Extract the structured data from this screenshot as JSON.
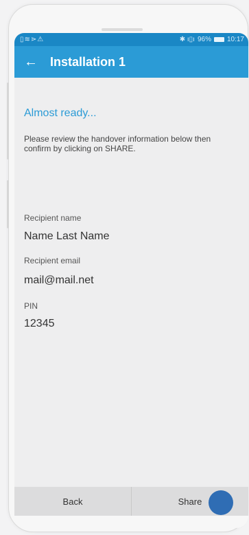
{
  "status_bar": {
    "left_icons": [
      "sim-icon",
      "wifi-icon",
      "nfc-icon",
      "warning-icon"
    ],
    "left_glyphs": "▯≋⋗⚠",
    "signal_glyph": "✱ ı▯ı",
    "battery_text": "96%",
    "time": "10:17"
  },
  "app_bar": {
    "back_glyph": "←",
    "title": "Installation 1"
  },
  "content": {
    "heading": "Almost ready...",
    "description": "Please review the handover information below then confirm by clicking on SHARE.",
    "fields": [
      {
        "label": "Recipient name",
        "value": "Name Last Name"
      },
      {
        "label": "Recipient email",
        "value": "mail@mail.net"
      },
      {
        "label": "PIN",
        "value": "12345"
      }
    ]
  },
  "bottom_bar": {
    "back_label": "Back",
    "share_label": "Share"
  },
  "colors": {
    "status_bar": "#1a87c5",
    "app_bar": "#2b9bd6",
    "accent": "#2b9bd6",
    "tap_indicator": "#2f6db4"
  }
}
